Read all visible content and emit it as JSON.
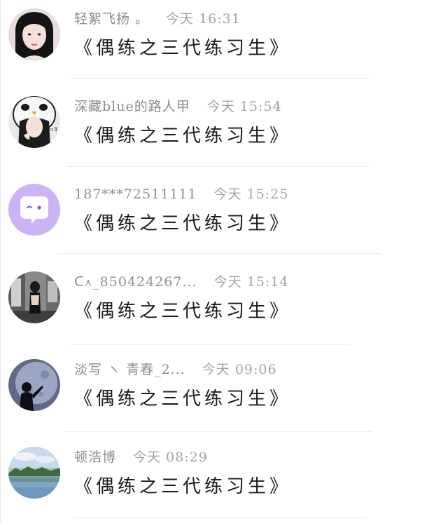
{
  "comments": [
    {
      "user": "轻絮飞扬 。",
      "time": "今天 16:31",
      "text": "《偶练之三代练习生》",
      "avatar": "girl-portrait"
    },
    {
      "user": "深藏blue的路人甲",
      "time": "今天 15:54",
      "text": "《偶练之三代练习生》",
      "avatar": "penguin-hat-girl"
    },
    {
      "user": "187***72511111",
      "time": "今天 15:25",
      "text": "《偶练之三代练习生》",
      "avatar": "default-chat-bubble"
    },
    {
      "user": "ᑕ᧘_850424267...",
      "time": "今天 15:14",
      "text": "《偶练之三代练习生》",
      "avatar": "girl-in-corridor"
    },
    {
      "user": "淡写 ヽ 青春_2...",
      "time": "今天 09:06",
      "text": "《偶练之三代练习生》",
      "avatar": "moon-silhouette"
    },
    {
      "user": "顿浩博",
      "time": "今天 08:29",
      "text": "《偶练之三代练习生》",
      "avatar": "lake-landscape"
    }
  ],
  "colors": {
    "username": "#8e8e8e",
    "time": "#a3a3a3",
    "comment": "#1b1b1b",
    "default_avatar": "#cdb3f5"
  }
}
